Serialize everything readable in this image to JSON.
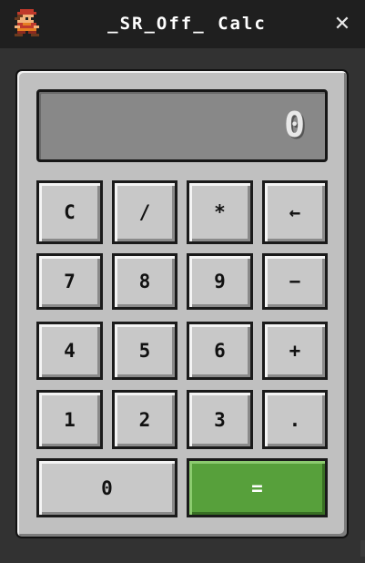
{
  "window": {
    "title": "_SR_Off_ Calc",
    "close_glyph": "✕",
    "app_icon": "pixel-character-icon"
  },
  "display": {
    "value": "0"
  },
  "keys": {
    "clear": "C",
    "divide": "/",
    "multiply": "*",
    "backspace": "←",
    "seven": "7",
    "eight": "8",
    "nine": "9",
    "subtract": "−",
    "four": "4",
    "five": "5",
    "six": "6",
    "add": "+",
    "one": "1",
    "two": "2",
    "three": "3",
    "decimal": ".",
    "zero": "0",
    "equals": "="
  },
  "colors": {
    "titlebar": "#1f1f1f",
    "window_bg": "#323232",
    "panel": "#c0c0c0",
    "display": "#888888",
    "key": "#c8c8c8",
    "equals_key": "#57a03b"
  }
}
